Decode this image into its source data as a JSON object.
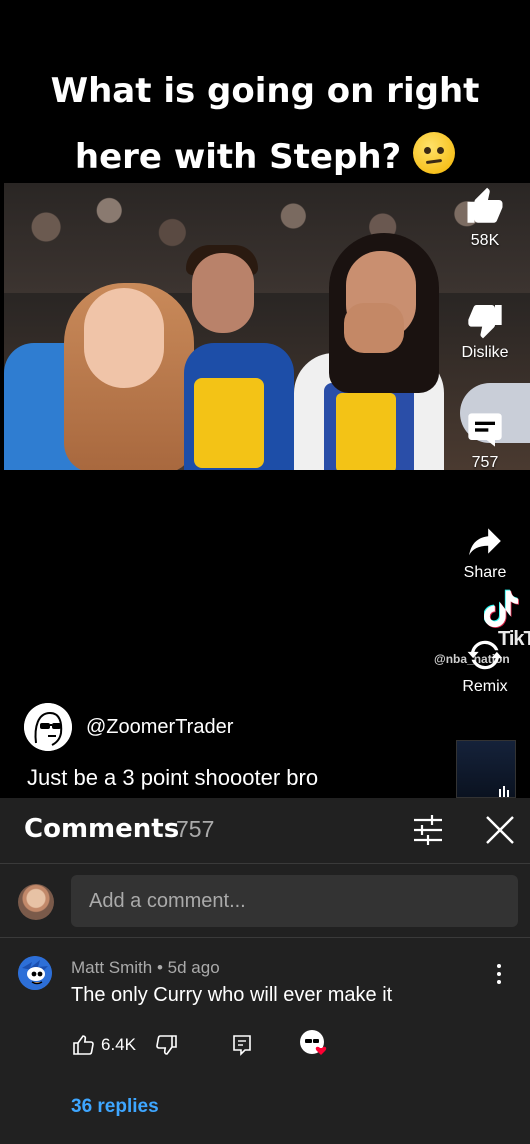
{
  "video": {
    "title_line1": "What is going on right",
    "title_line2": "here with Steph?"
  },
  "rail": {
    "likes": "58K",
    "dislike_label": "Dislike",
    "comments_count": "757",
    "share_label": "Share",
    "remix_label": "Remix"
  },
  "watermark": {
    "word": "TikTok",
    "handle": "@nba_nation"
  },
  "channel": {
    "handle": "@ZoomerTrader",
    "caption": "Just be a 3 point shoooter bro"
  },
  "comments_panel": {
    "title": "Comments",
    "count": "757",
    "input_placeholder": "Add a comment..."
  },
  "comment": {
    "author": "Matt Smith",
    "age": "5d ago",
    "text": "The only Curry who will ever make it",
    "likes": "6.4K",
    "replies": "36 replies"
  },
  "colors": {
    "sheet_bg": "#212121",
    "link_blue": "#3ea6ff",
    "heart_red": "#ff0033"
  }
}
